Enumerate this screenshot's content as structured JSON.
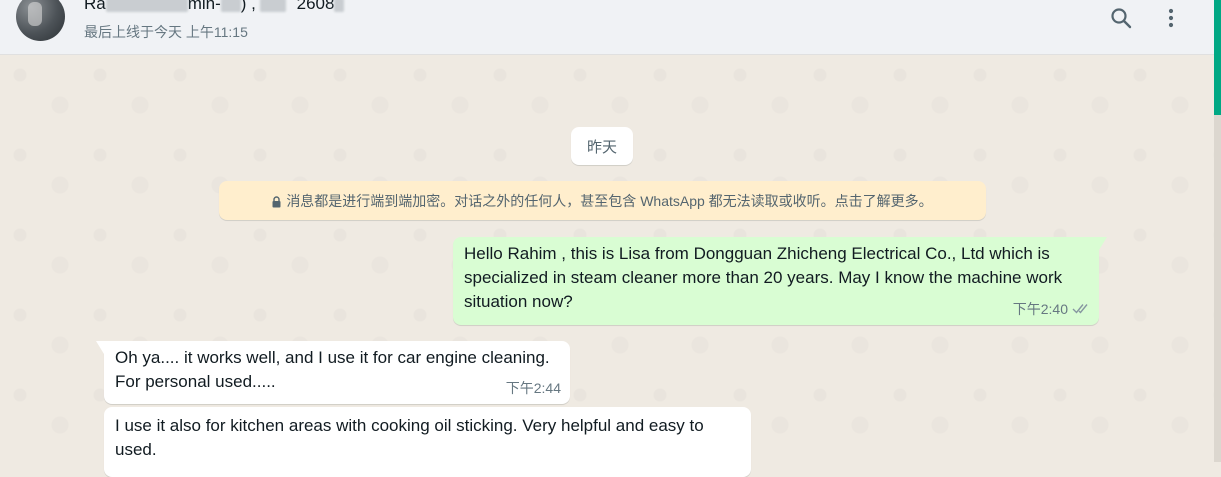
{
  "header": {
    "contact_name_start": "Ra",
    "contact_name_mid": "min-",
    "contact_name_mid2": ") ,",
    "contact_name_num": "2608",
    "last_seen": "最后上线于今天 上午11:15",
    "search_icon": "search-icon",
    "menu_icon": "more-vertical-icon"
  },
  "chat": {
    "date_chip": "昨天",
    "encryption_notice": "消息都是进行端到端加密。对话之外的任何人，甚至包含 WhatsApp 都无法读取或收听。点击了解更多。",
    "messages": [
      {
        "direction": "outgoing",
        "lines": [
          "Hello Rahim , this is Lisa from Dongguan Zhicheng Electrical Co., Ltd which is",
          "specialized in steam cleaner more than 20 years. May I know the machine work",
          "situation now?"
        ],
        "time": "下午2:40",
        "status": "read"
      },
      {
        "direction": "incoming",
        "lines": [
          "Oh ya.... it works well, and I use it for car engine cleaning.",
          "For personal used....."
        ],
        "time": "下午2:44"
      },
      {
        "direction": "incoming",
        "lines": [
          "I use it also for kitchen areas with cooking oil sticking. Very helpful and easy to",
          "used."
        ]
      }
    ]
  },
  "colors": {
    "outgoing_bubble": "#d9fdd3",
    "incoming_bubble": "#ffffff",
    "encryption_bg": "#ffeecd",
    "accent": "#00a884"
  }
}
